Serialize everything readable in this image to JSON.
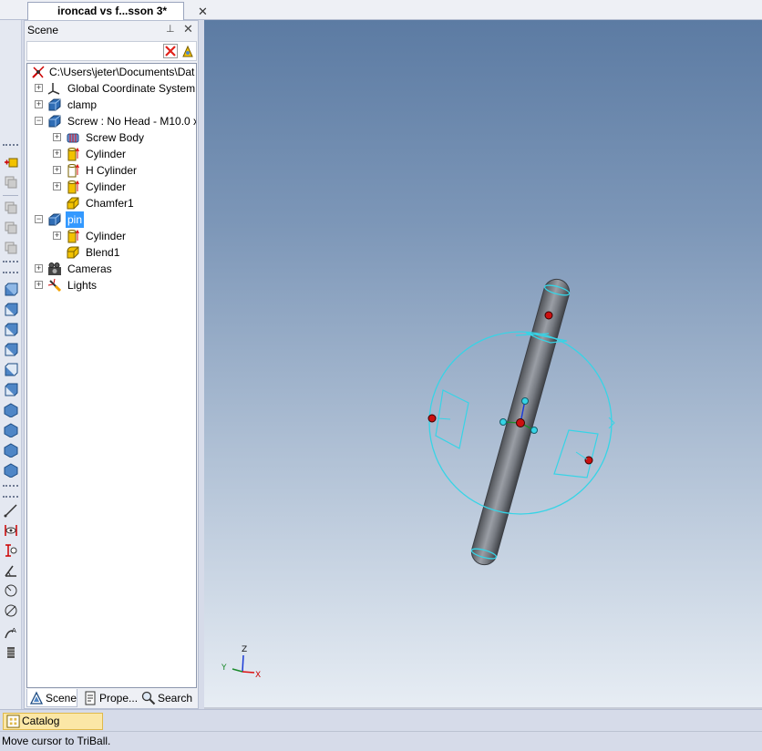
{
  "document_tab": {
    "title": "ironcad vs f...sson 3*",
    "close": "✕"
  },
  "scene_panel": {
    "title": "Scene",
    "pin": "⊥",
    "close": "✕",
    "tree": {
      "root": "C:\\Users\\jeter\\Documents\\Dat",
      "gcs": "Global Coordinate System",
      "clamp": "clamp",
      "screw": "Screw : No Head - M10.0 x",
      "screw_body": "Screw Body",
      "cyl1": "Cylinder",
      "hcyl": "H Cylinder",
      "cyl2": "Cylinder",
      "chamfer": "Chamfer1",
      "pin": "pin",
      "pin_cyl": "Cylinder",
      "blend": "Blend1",
      "cameras": "Cameras",
      "lights": "Lights"
    },
    "tabs": {
      "scene": "Scene",
      "properties": "Prope...",
      "search": "Search"
    }
  },
  "triad_axes": {
    "x": "X",
    "y": "Y",
    "z": "Z"
  },
  "catalog_browser": {
    "label": "Catalog Browser"
  },
  "status": {
    "text": "Move cursor to TriBall."
  },
  "colors": {
    "selection": "#3399ff",
    "triball_ring": "#36d4e6",
    "anchor_point": "#cc1010",
    "catalog_button": "#fbe7a6"
  }
}
